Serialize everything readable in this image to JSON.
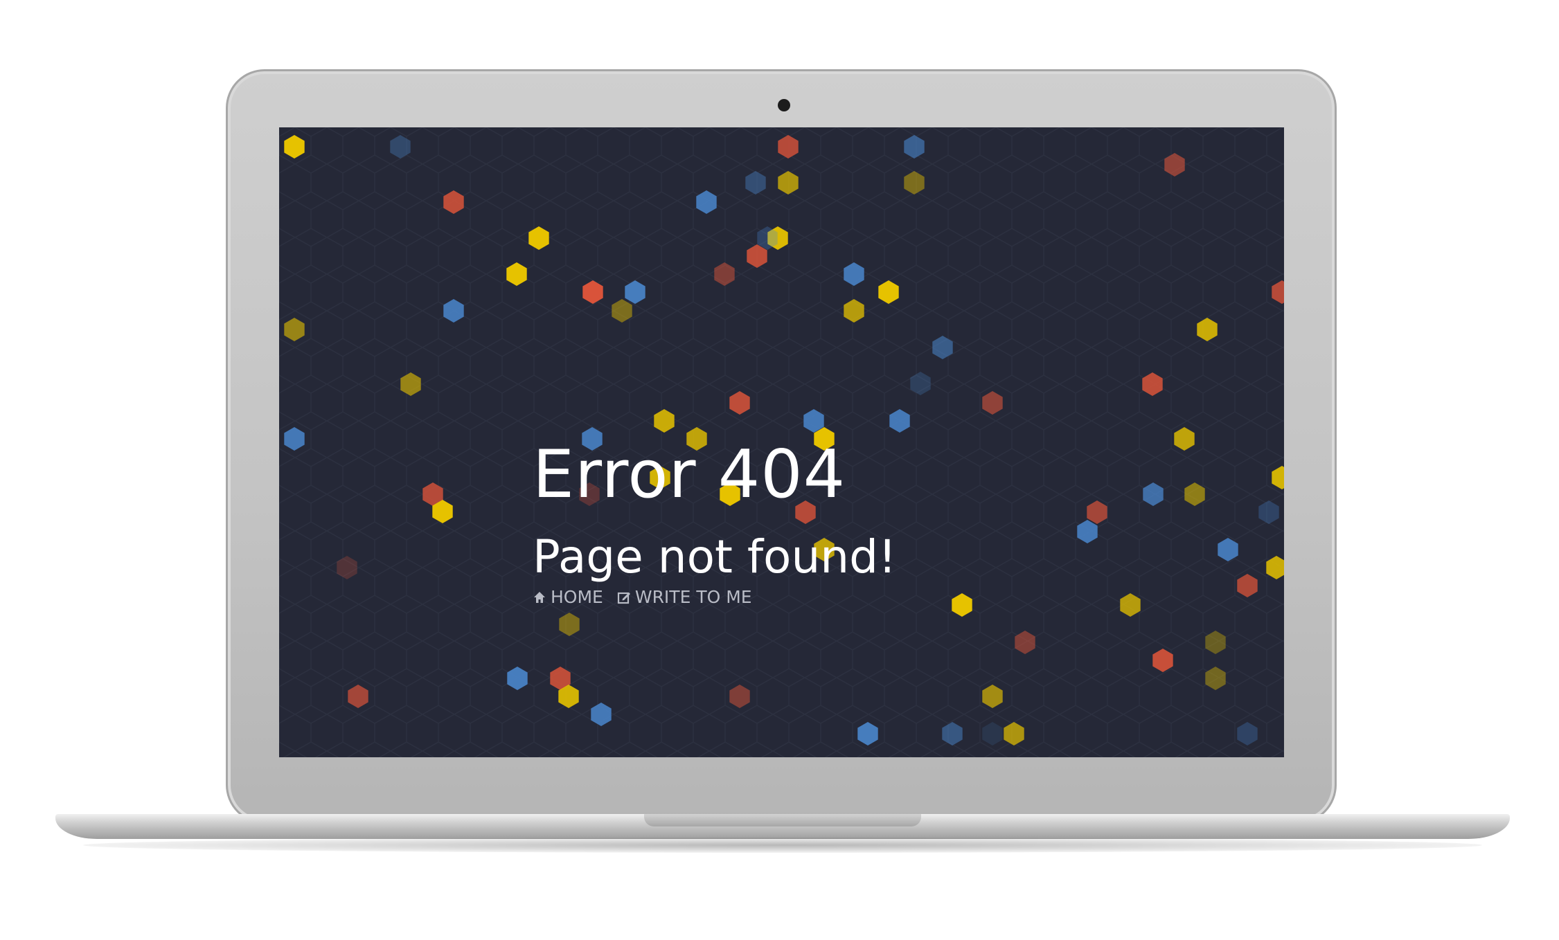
{
  "page": {
    "error_title": "Error 404",
    "message": "Page not found!",
    "links": [
      {
        "icon": "home-icon",
        "label": "HOME"
      },
      {
        "icon": "edit-icon",
        "label": "WRITE TO ME"
      }
    ]
  },
  "colors": {
    "screen_background": "#252837",
    "hex_grid_line": "#2d3142",
    "yellow": "#e6c200",
    "red": "#d9533a",
    "blue": "#4a86cc",
    "text": "#ffffff",
    "link_text": "#b9bcc6"
  }
}
